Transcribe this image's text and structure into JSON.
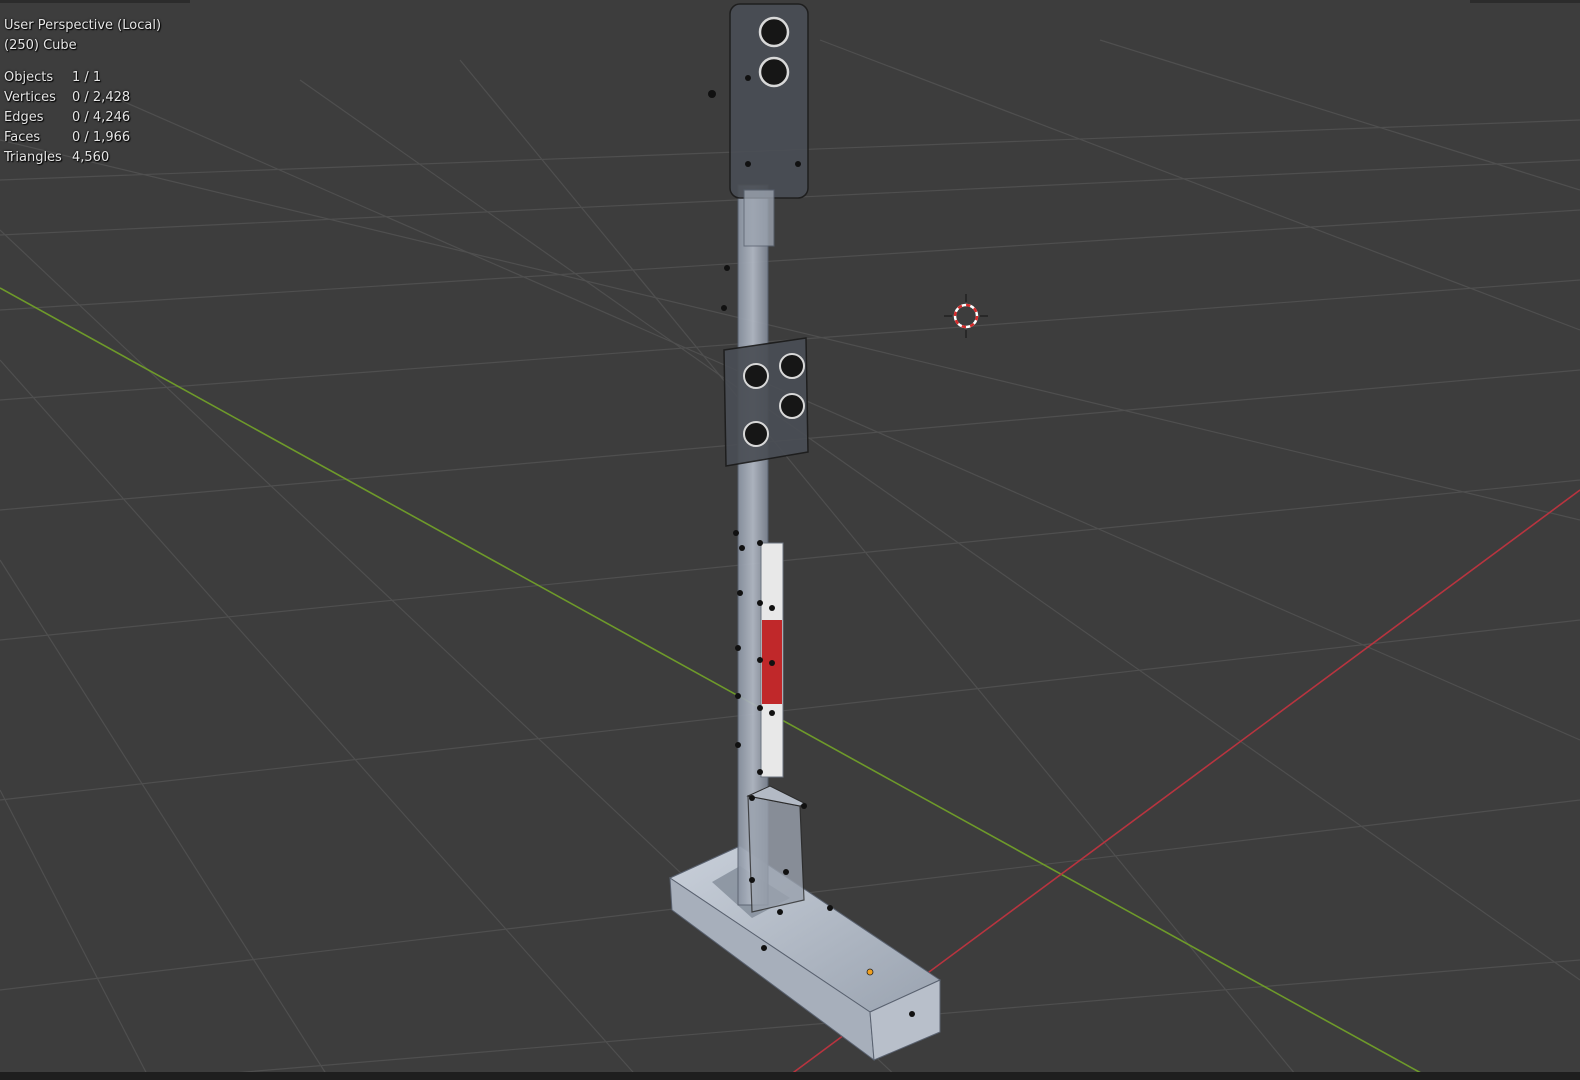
{
  "viewport": {
    "view_name": "User Perspective (Local)",
    "object_line": "(250) Cube"
  },
  "statistics": [
    {
      "label": "Objects",
      "value": "1 / 1"
    },
    {
      "label": "Vertices",
      "value": "0 / 2,428"
    },
    {
      "label": "Edges",
      "value": "0 / 4,246"
    },
    {
      "label": "Faces",
      "value": "0 / 1,966"
    },
    {
      "label": "Triangles",
      "value": "4,560"
    }
  ],
  "icons": {
    "cursor": "3d-cursor-icon",
    "origin": "object-origin-icon"
  },
  "colors": {
    "background": "#3d3d3d",
    "grid": "#4e4e4e",
    "x_axis": "#b8343f",
    "y_axis": "#6e9a2a",
    "stripe_red": "#c0282a",
    "stripe_white": "#e8e8e8"
  }
}
